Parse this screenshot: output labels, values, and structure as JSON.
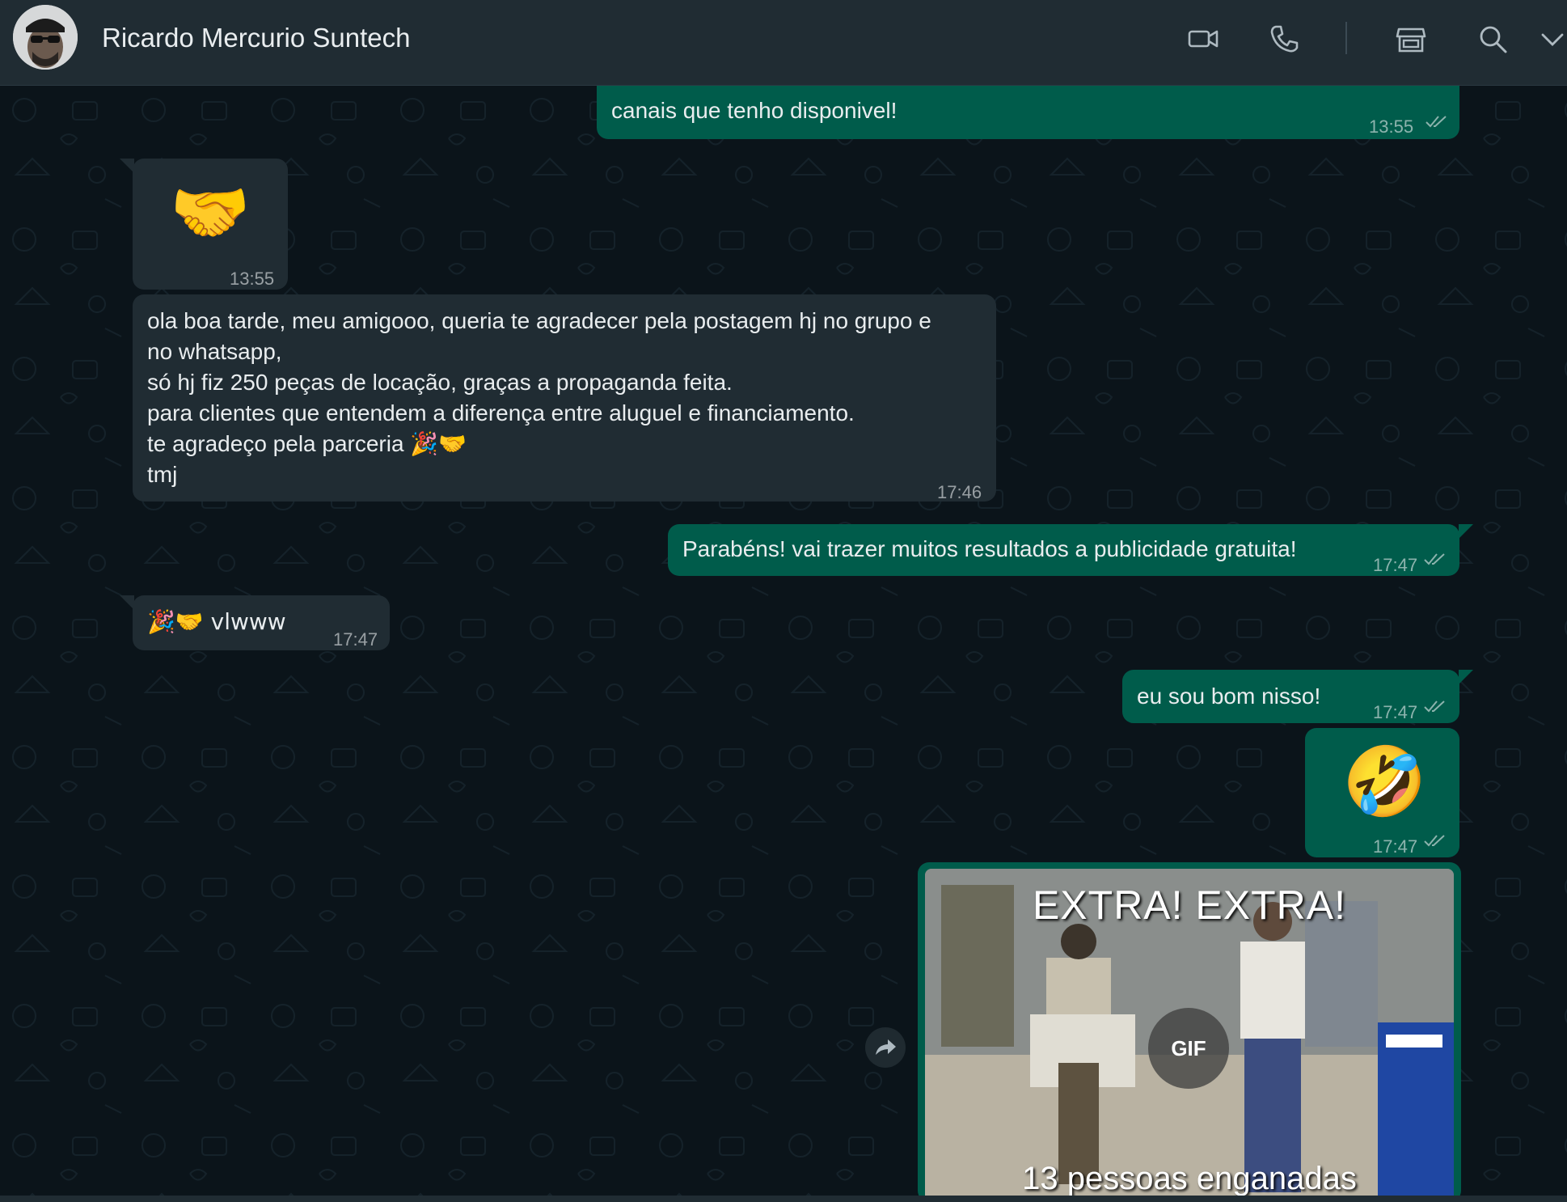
{
  "header": {
    "contact_name": "Ricardo Mercurio Suntech",
    "icons": [
      "video-call-icon",
      "voice-call-icon",
      "shop-icon",
      "search-icon",
      "chevron-down-icon"
    ]
  },
  "messages": [
    {
      "direction": "out",
      "text": "canais que tenho disponivel!",
      "time": "13:55",
      "status": "read"
    },
    {
      "direction": "in",
      "emoji": "🤝",
      "time": "13:55"
    },
    {
      "direction": "in",
      "lines": [
        "ola boa tarde, meu amigooo, queria te agradecer pela postagem hj no grupo e",
        "no whatsapp,",
        "só hj fiz 250 peças de locação, graças a propaganda feita.",
        "para clientes que entendem a diferença entre aluguel e financiamento.",
        "te agradeço pela parceria 🎉🤝",
        "tmj"
      ],
      "time": "17:46"
    },
    {
      "direction": "out",
      "text": "Parabéns! vai trazer muitos resultados a publicidade gratuita!",
      "time": "17:47",
      "status": "read"
    },
    {
      "direction": "in",
      "text": "🎉🤝 vlwww",
      "time": "17:47"
    },
    {
      "direction": "out",
      "text": "eu sou bom nisso!",
      "time": "17:47",
      "status": "read"
    },
    {
      "direction": "out",
      "emoji": "🤣",
      "time": "17:47",
      "status": "read"
    },
    {
      "direction": "out",
      "type": "gif",
      "caption_top": "EXTRA! EXTRA!",
      "caption_bottom": "13 pessoas enganadas",
      "badge": "GIF"
    }
  ],
  "colors": {
    "header_bg": "#202c33",
    "chat_bg": "#0b141a",
    "incoming_bubble": "#202c33",
    "outgoing_bubble": "#005c4b"
  }
}
